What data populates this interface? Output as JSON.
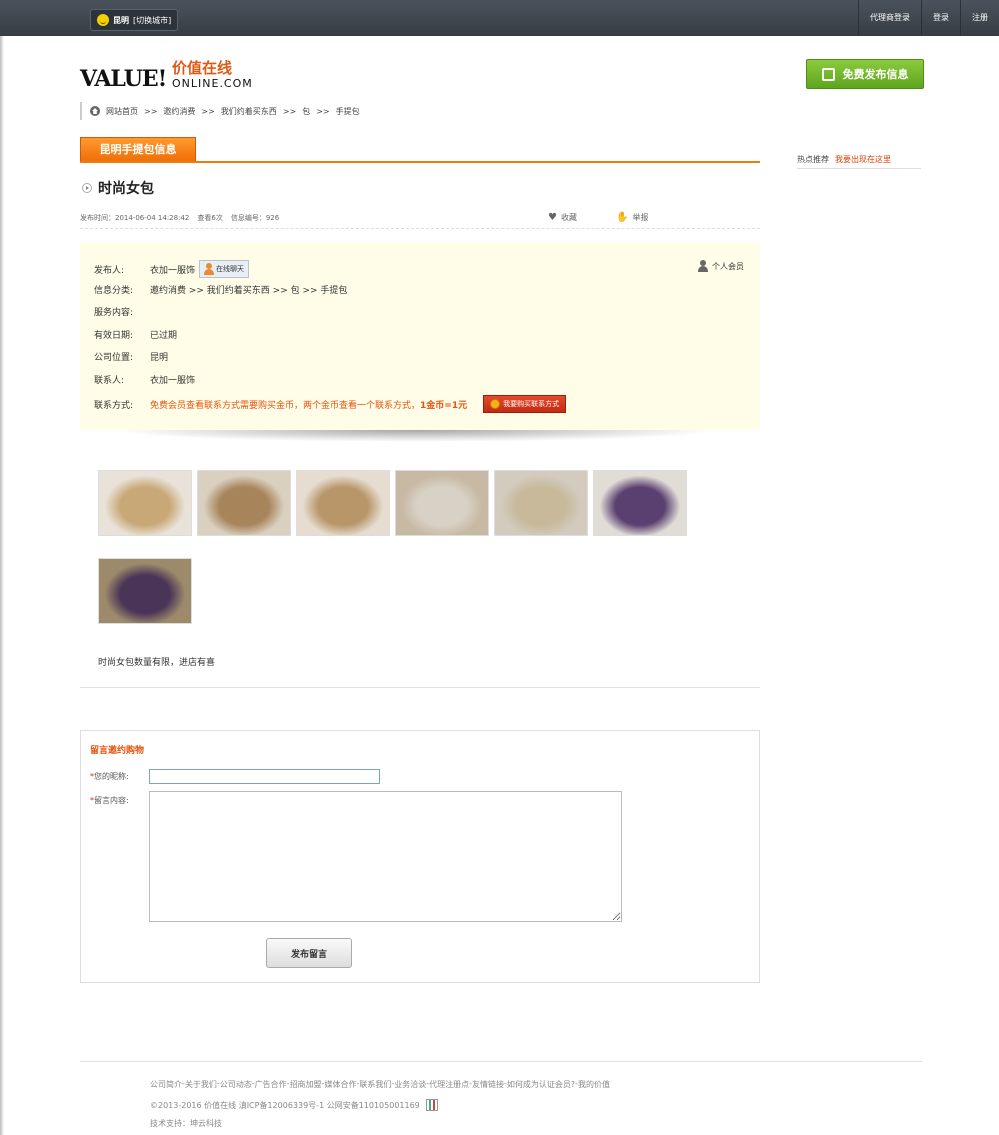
{
  "topbar": {
    "city": "昆明",
    "switch_city": "[切换城市]",
    "links": [
      "代理商登录",
      "登录",
      "注册"
    ]
  },
  "logo": {
    "brand": "VALUE!",
    "cn": "价值在线",
    "domain": "ONLINE.COM"
  },
  "publish_button": "免费发布信息",
  "breadcrumb": [
    "网站首页",
    ">>",
    "邀约消费",
    ">>",
    "我们约着买东西",
    ">>",
    "包",
    ">>",
    "手提包"
  ],
  "section_tab": "昆明手提包信息",
  "hot": {
    "label": "热点推荐",
    "link": "我要出现在这里"
  },
  "post": {
    "title": "时尚女包",
    "published": "发布时间：2014-06-04 14:28:42",
    "views": "查看6次",
    "info_id": "信息编号：926",
    "favorite": "收藏",
    "report": "举报"
  },
  "info": {
    "publisher_label": "发布人:",
    "publisher": "衣加一服饰",
    "chat": "在线聊天",
    "member": "个人会员",
    "category_label": "信息分类:",
    "category": "邀约消费 >> 我们约着买东西 >> 包 >> 手提包",
    "service_label": "服务内容:",
    "service": "",
    "valid_label": "有效日期:",
    "valid": "已过期",
    "location_label": "公司位置:",
    "location": "昆明",
    "contact_label": "联系人:",
    "contact": "衣加一服饰",
    "method_label": "联系方式:",
    "method_text": "免费会员查看联系方式需要购买金币，两个金币查看一个联系方式，",
    "rate": "1金币=1元",
    "buy_button": "我要购买联系方式"
  },
  "thumbnails": [
    {
      "colors": [
        "#e8e2d8",
        "#c9a877"
      ]
    },
    {
      "colors": [
        "#d9d0c0",
        "#a8845a"
      ]
    },
    {
      "colors": [
        "#e6ddd0",
        "#b8966a"
      ]
    },
    {
      "colors": [
        "#c8b9a4",
        "#d8d2c6"
      ]
    },
    {
      "colors": [
        "#d2cbbe",
        "#c7b99a"
      ]
    },
    {
      "colors": [
        "#e0dcd6",
        "#5a4070"
      ]
    },
    {
      "colors": [
        "#9c8a6a",
        "#4a3458"
      ]
    }
  ],
  "description": "时尚女包数量有限，进店有喜",
  "message": {
    "title": "留言邀约购物",
    "nickname_label": "您的昵称:",
    "content_label": "留言内容:",
    "submit": "发布留言"
  },
  "footer": {
    "links": [
      "公司简介",
      "关于我们",
      "公司动态",
      "广告合作",
      "招商加盟",
      "媒体合作",
      "联系我们",
      "业务洽谈",
      "代理注册点",
      "友情链接",
      "如何成为认证会员?",
      "我的价值"
    ],
    "copyright": "©2013-2016 价值在线 滇ICP备12006339号-1   公网安备110105001169",
    "support": "技术支持：坤云科技"
  }
}
